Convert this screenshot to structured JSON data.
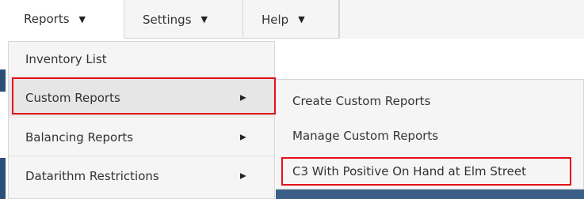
{
  "menubar": {
    "items": [
      {
        "label": "Reports",
        "arrow": "▼"
      },
      {
        "label": "Settings",
        "arrow": "▼"
      },
      {
        "label": "Help",
        "arrow": "▼"
      }
    ]
  },
  "dropdown": {
    "items": [
      {
        "label": "Inventory List"
      },
      {
        "label": "Custom Reports",
        "arrow": "▶",
        "highlighted": true
      },
      {
        "label": "Balancing Reports",
        "arrow": "▶"
      },
      {
        "label": "Datarithm Restrictions",
        "arrow": "▶"
      }
    ]
  },
  "submenu": {
    "items": [
      {
        "label": "Create Custom Reports"
      },
      {
        "label": "Manage Custom Reports"
      },
      {
        "label": "C3 With Positive On Hand at Elm Street",
        "highlighted": true
      }
    ]
  },
  "colors": {
    "highlight_border": "#e4101a",
    "menu_background": "#f5f5f5",
    "accent_band": "#2c4f78"
  },
  "icons": {
    "dropdown_arrow": "caret-down-icon",
    "submenu_arrow": "caret-right-icon"
  }
}
